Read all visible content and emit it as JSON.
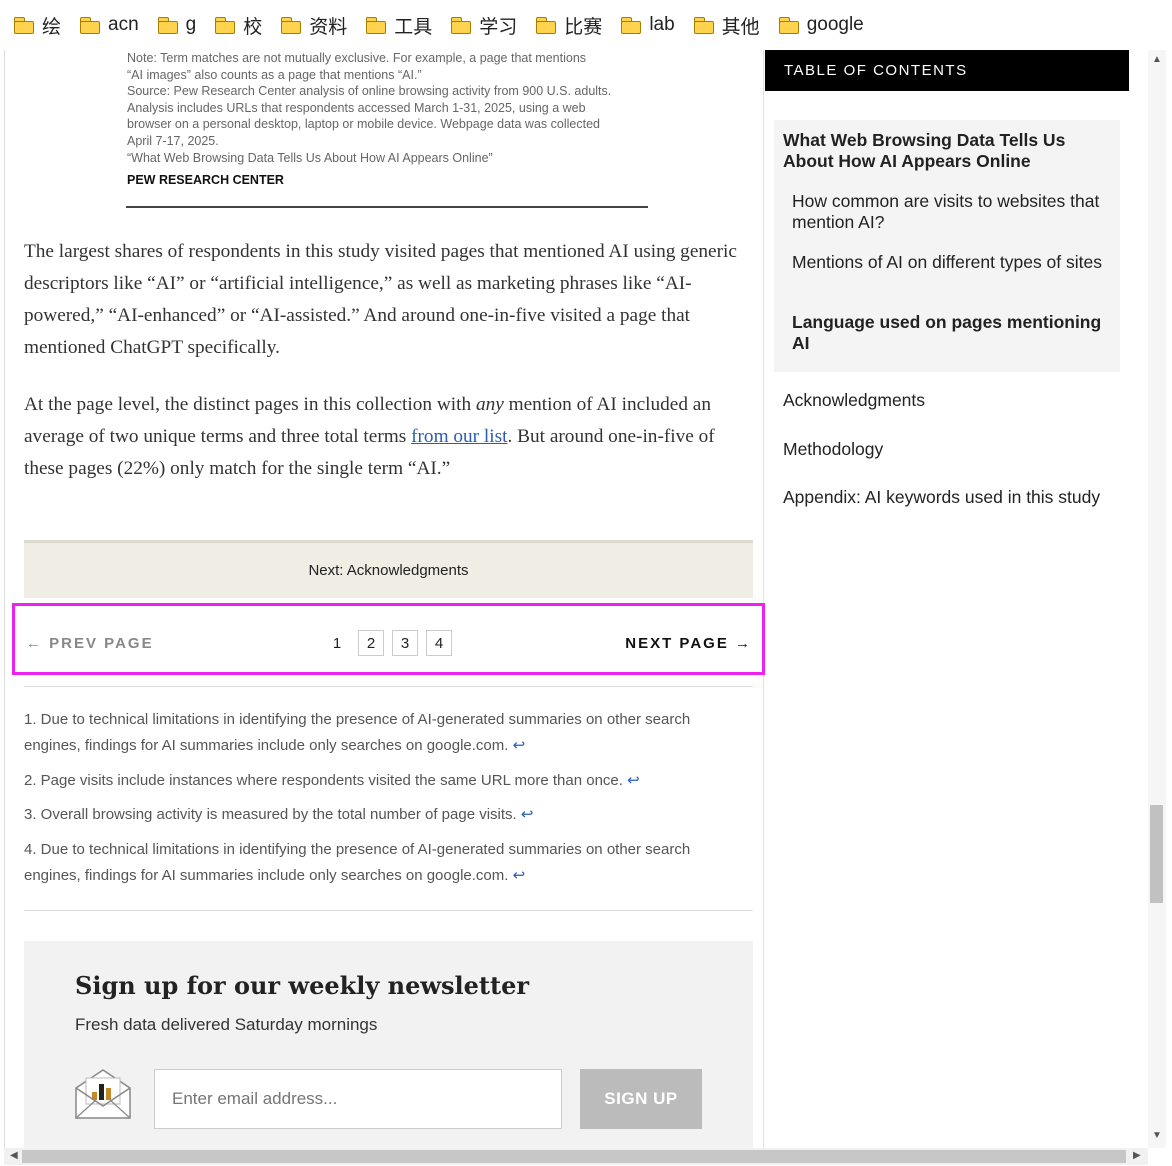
{
  "bookmarks": [
    "绘",
    "acn",
    "g",
    "校",
    "资料",
    "工具",
    "学习",
    "比赛",
    "lab",
    "其他",
    "google"
  ],
  "figure_note": {
    "lines": [
      "Note: Term matches are not mutually exclusive. For example, a page that mentions",
      "“AI images” also counts as a page that mentions “AI.”",
      "Source: Pew Research Center analysis of online browsing activity from 900 U.S. adults.",
      "Analysis includes URLs that respondents accessed March 1-31, 2025, using a web",
      "browser on a personal desktop, laptop or mobile device. Webpage data was collected",
      "April 7-17, 2025.",
      "“What Web Browsing Data Tells Us About How AI Appears Online”"
    ],
    "brand": "PEW RESEARCH CENTER"
  },
  "body": {
    "p1": "The largest shares of respondents in this study visited pages that mentioned AI using generic descriptors like “AI” or “artificial intelligence,” as well as marketing phrases like “AI-powered,” “AI-enhanced” or “AI-assisted.” And around one-in-five visited a page that mentioned ChatGPT specifically.",
    "p2_a": "At the page level, the distinct pages in this collection with ",
    "p2_em": "any",
    "p2_b": " mention of AI included an average of two unique terms and three total terms ",
    "p2_link": "from our list",
    "p2_c": ". But around one-in-five of these pages (22%) only match for the single term “AI.”"
  },
  "next_box": "Next: Acknowledgments",
  "pager": {
    "prev": "← PREV PAGE",
    "next": "NEXT PAGE →",
    "pages": [
      "1",
      "2",
      "3",
      "4"
    ],
    "current": "1"
  },
  "footnotes": [
    "1. Due to technical limitations in identifying the presence of AI-generated summaries on other search engines, findings for AI summaries include only searches on google.com.",
    "2. Page visits include instances where respondents visited the same URL more than once.",
    "3. Overall browsing activity is measured by the total number of page visits.",
    "4. Due to technical limitations in identifying the presence of AI-generated summaries on other search engines, findings for AI summaries include only searches on google.com."
  ],
  "back_arrow": "↩",
  "newsletter": {
    "title": "Sign up for our weekly newsletter",
    "subtitle": "Fresh data delivered Saturday mornings",
    "placeholder": "Enter email address...",
    "button": "SIGN UP"
  },
  "toc": {
    "heading": "TABLE OF CONTENTS",
    "main": "What Web Browsing Data Tells Us About How AI Appears Online",
    "subs": [
      "How common are visits to websites that mention AI?",
      "Mentions of AI on different types of sites",
      "Language used on pages mentioning AI"
    ],
    "links": [
      "Acknowledgments",
      "Methodology",
      "Appendix: AI keywords used in this study"
    ]
  },
  "colors": {
    "highlight_outline": "#ee22ee",
    "link": "#2a5db0",
    "next_box_bg": "#efede4",
    "toc_head_bg": "#000000"
  }
}
